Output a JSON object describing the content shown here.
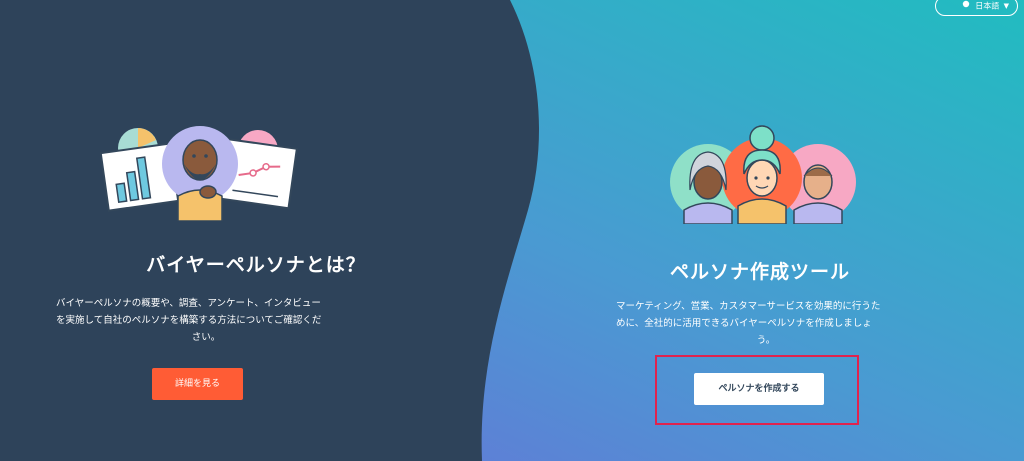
{
  "left": {
    "title": "バイヤーペルソナとは？",
    "description_lines": [
      "バイヤーペルソナの概要や、調査、アンケート、インタビュー",
      "を実施して自社のペルソナを構築する方法についてご確認くだ",
      "さい。"
    ],
    "cta_label": "詳細を見る"
  },
  "right": {
    "title": "ペルソナ作成ツール",
    "description_lines": [
      "マーケティング、営業、カスタマーサービスを効果的に行うた",
      "めに、全社的に活用できるバイヤーペルソナを作成しましょ",
      "う。"
    ],
    "cta_label": "ペルソナを作成する"
  },
  "language_selector": {
    "label": "日本語"
  },
  "colors": {
    "left_bg": "#2e435a",
    "gradient_top": "#27b5c3",
    "gradient_bottom": "#6b6fd8",
    "cta_orange": "#ff5c35",
    "highlight_red": "#e0234e"
  },
  "icons": [
    "globe-icon",
    "chevron-down-icon"
  ]
}
